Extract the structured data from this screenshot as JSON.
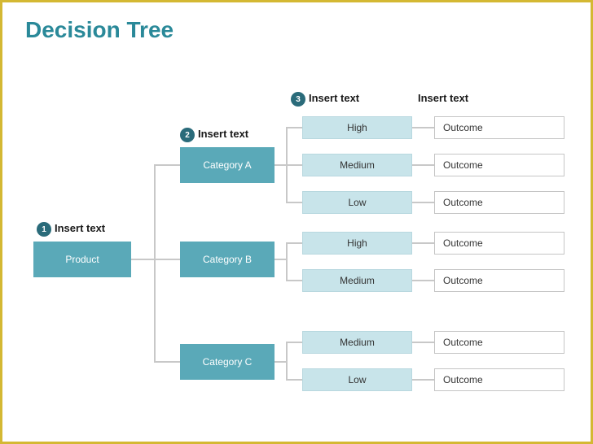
{
  "title": "Decision Tree",
  "headers": {
    "level1": "Insert text",
    "level2": "Insert text",
    "level3": "Insert text",
    "level4": "Insert text"
  },
  "badges": {
    "b1": "1",
    "b2": "2",
    "b3": "3"
  },
  "tree": {
    "root": "Product",
    "categories": {
      "a": {
        "label": "Category A",
        "levels": [
          "High",
          "Medium",
          "Low"
        ],
        "outcomes": [
          "Outcome",
          "Outcome",
          "Outcome"
        ]
      },
      "b": {
        "label": "Category B",
        "levels": [
          "High",
          "Medium"
        ],
        "outcomes": [
          "Outcome",
          "Outcome"
        ]
      },
      "c": {
        "label": "Category C",
        "levels": [
          "Medium",
          "Low"
        ],
        "outcomes": [
          "Outcome",
          "Outcome"
        ]
      }
    }
  }
}
